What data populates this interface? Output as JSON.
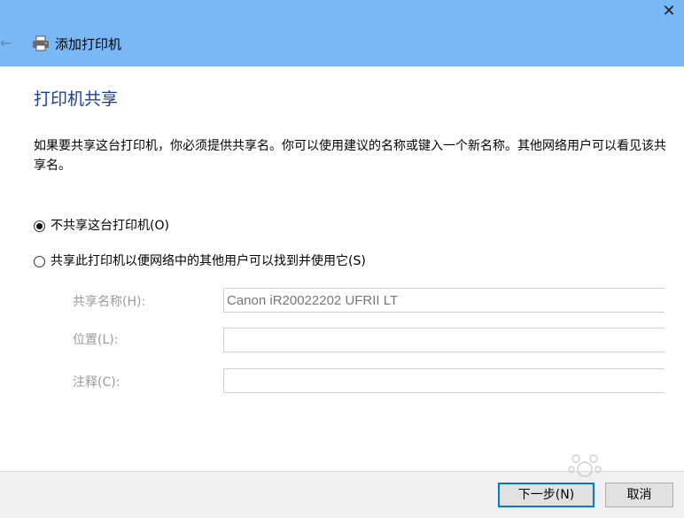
{
  "window": {
    "title": "添加打印机",
    "close_glyph": "✕",
    "back_glyph": "←"
  },
  "page": {
    "heading": "打印机共享",
    "description": "如果要共享这台打印机，你必须提供共享名。你可以使用建议的名称或键入一个新名称。其他网络用户可以看见该共享名。"
  },
  "options": {
    "no_share": {
      "label": "不共享这台打印机(O)",
      "checked": true
    },
    "share": {
      "label": "共享此打印机以便网络中的其他用户可以找到并使用它(S)",
      "checked": false
    }
  },
  "fields": {
    "share_name": {
      "label": "共享名称(H):",
      "value": "Canon iR20022202 UFRII LT"
    },
    "location": {
      "label": "位置(L):",
      "value": ""
    },
    "comment": {
      "label": "注释(C):",
      "value": ""
    }
  },
  "buttons": {
    "next": "下一步(N)",
    "cancel": "取消"
  },
  "colors": {
    "titlebar": "#7ab8f5",
    "heading": "#1c3f99",
    "disabled_text": "#9a9a9a",
    "primary_border": "#0078d7"
  }
}
